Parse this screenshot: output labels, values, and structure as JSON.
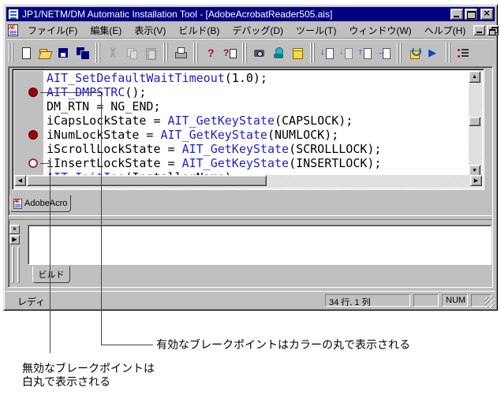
{
  "window": {
    "title": "JP1/NETM/DM Automatic Installation Tool - [AdobeAcrobatReader505.ais]",
    "controls": [
      "minimize",
      "maximize",
      "close"
    ],
    "mdi_controls": [
      "minimize",
      "restore",
      "close"
    ]
  },
  "menubar": {
    "items": [
      {
        "id": "file",
        "label": "ファイル(F)"
      },
      {
        "id": "edit",
        "label": "編集(E)"
      },
      {
        "id": "view",
        "label": "表示(V)"
      },
      {
        "id": "build",
        "label": "ビルド(B)"
      },
      {
        "id": "debug",
        "label": "デバッグ(D)"
      },
      {
        "id": "tools",
        "label": "ツール(T)"
      },
      {
        "id": "window",
        "label": "ウィンドウ(W)"
      },
      {
        "id": "help",
        "label": "ヘルプ(H)"
      }
    ]
  },
  "toolbar": {
    "groups": [
      {
        "items": [
          {
            "n": "new-file"
          },
          {
            "n": "open-file"
          },
          {
            "n": "save-file"
          },
          {
            "n": "save-all"
          }
        ]
      },
      {
        "items": [
          {
            "n": "cut",
            "d": true
          },
          {
            "n": "copy",
            "d": true
          },
          {
            "n": "paste",
            "d": true
          }
        ]
      },
      {
        "items": [
          {
            "n": "print"
          }
        ]
      },
      {
        "items": [
          {
            "n": "help"
          },
          {
            "n": "context-help"
          }
        ]
      },
      {
        "items": [
          {
            "n": "capture-camera"
          },
          {
            "n": "setup-wizard"
          },
          {
            "n": "package-box"
          }
        ]
      },
      {
        "items": [
          {
            "n": "get-script",
            "arrow": "↓"
          },
          {
            "n": "verify-script",
            "d": true,
            "arrow": "↓"
          },
          {
            "n": "register-script",
            "arrow": "↑"
          },
          {
            "n": "apply-script",
            "arrow": "→"
          }
        ]
      },
      {
        "items": [
          {
            "n": "deploy-package"
          },
          {
            "n": "run"
          }
        ]
      },
      {
        "items": [
          {
            "n": "breakpoint-list"
          }
        ]
      }
    ]
  },
  "editor": {
    "tab_label": "AdobeAcrob...",
    "lines": [
      {
        "bp": null,
        "segs": [
          {
            "t": "AIT_SetDefaultWaitTimeout",
            "c": "f"
          },
          {
            "t": "(1.0);",
            "c": "p"
          }
        ]
      },
      {
        "bp": "enabled",
        "segs": [
          {
            "t": "AIT_DMPSTRC",
            "c": "f"
          },
          {
            "t": "();",
            "c": "p"
          }
        ]
      },
      {
        "bp": null,
        "segs": [
          {
            "t": "DM_RTN = NG_END;",
            "c": "p"
          }
        ]
      },
      {
        "bp": null,
        "segs": [
          {
            "t": "iCapsLockState = ",
            "c": "p"
          },
          {
            "t": "AIT_GetKeyState",
            "c": "f"
          },
          {
            "t": "(CAPSLOCK);",
            "c": "p"
          }
        ]
      },
      {
        "bp": "enabled",
        "segs": [
          {
            "t": "iNumLockState = ",
            "c": "p"
          },
          {
            "t": "AIT_GetKeyState",
            "c": "f"
          },
          {
            "t": "(NUMLOCK);",
            "c": "p"
          }
        ]
      },
      {
        "bp": null,
        "segs": [
          {
            "t": "iScrollLockState = ",
            "c": "p"
          },
          {
            "t": "AIT_GetKeyState",
            "c": "f"
          },
          {
            "t": "(SCROLLLOCK);",
            "c": "p"
          }
        ]
      },
      {
        "bp": "disabled",
        "segs": [
          {
            "t": "iInsertLockState = ",
            "c": "p"
          },
          {
            "t": "AIT_GetKeyState",
            "c": "f"
          },
          {
            "t": "(INSERTLOCK);",
            "c": "p"
          }
        ]
      },
      {
        "bp": null,
        "segs": [
          {
            "t": "AIT_InitIns",
            "c": "f"
          },
          {
            "t": "(InstallerName);",
            "c": "p"
          }
        ]
      }
    ]
  },
  "output": {
    "tab_label": "ビルド"
  },
  "statusbar": {
    "ready": "レディ",
    "cursor_position": "34 行, 1 列",
    "num_lock": "NUM"
  },
  "annotations": {
    "enabled_note": "有効なブレークポイントはカラーの丸で表示される",
    "disabled_note_line1": "無効なブレークポイントは",
    "disabled_note_line2": "白丸で表示される"
  },
  "colors": {
    "titlebar": "#000080",
    "function_name": "#2020cc",
    "breakpoint_enabled": "#9c0000",
    "breakpoint_disabled_border": "#993333",
    "chrome": "#c0c0c0"
  }
}
